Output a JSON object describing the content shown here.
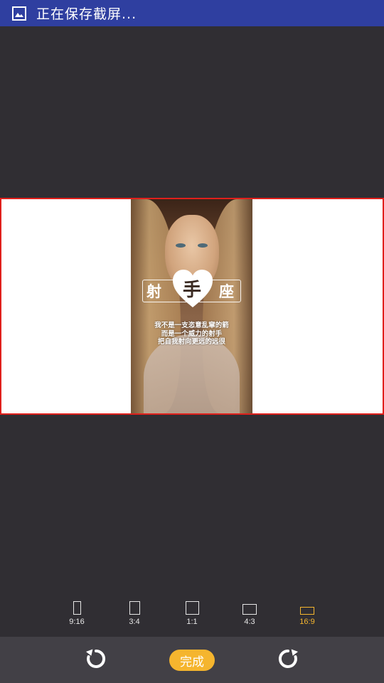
{
  "status_bar": {
    "icon": "image-icon",
    "text": "正在保存截屏..."
  },
  "colors": {
    "status_bar_bg": "#2f3fa0",
    "background": "#302e33",
    "crop_border": "#e0201c",
    "accent": "#f5b52e",
    "action_bar_bg": "#424046"
  },
  "poster": {
    "title_chars": [
      "射",
      "手",
      "座"
    ],
    "poem_lines": [
      "我不是一支恣意乱窜的箭",
      "而是一个威力的射手",
      "把自我射向更远的远很"
    ]
  },
  "aspect_ratios": [
    {
      "label": "9:16",
      "active": false
    },
    {
      "label": "3:4",
      "active": false
    },
    {
      "label": "1:1",
      "active": false
    },
    {
      "label": "4:3",
      "active": false
    },
    {
      "label": "16:9",
      "active": true
    }
  ],
  "actions": {
    "rotate_left_icon": "rotate-left-icon",
    "done_label": "完成",
    "rotate_right_icon": "rotate-right-icon"
  }
}
